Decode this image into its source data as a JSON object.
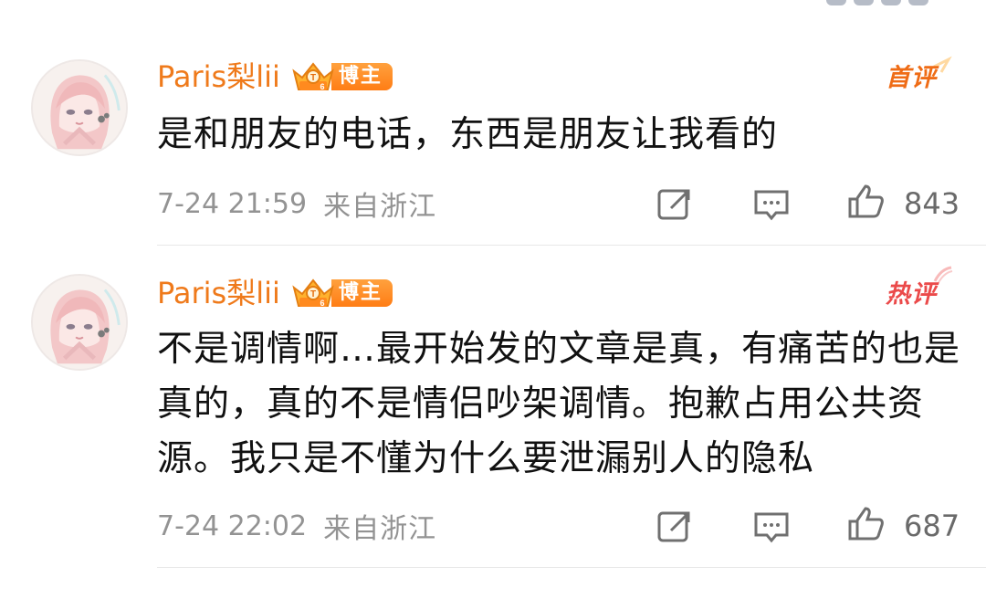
{
  "comments": [
    {
      "username": "Paris梨lii",
      "badge_label": "博主",
      "tag": "首评",
      "content": "是和朋友的电话，东西是朋友让我看的",
      "time": "7-24 21:59",
      "location": "来自浙江",
      "likes": "843"
    },
    {
      "username": "Paris梨lii",
      "badge_label": "博主",
      "tag": "热评",
      "content": "不是调情啊…最开始发的文章是真，有痛苦的也是真的，真的不是情侣吵架调情。抱歉占用公共资源。我只是不懂为什么要泄漏别人的隐私",
      "time": "7-24 22:02",
      "location": "来自浙江",
      "likes": "687"
    }
  ],
  "colors": {
    "username": "#ef7a1b",
    "tag_first": "#ef6c16",
    "tag_hot": "#eb4a4a",
    "badge_orange": "#ff8a1f",
    "meta_gray": "#939393",
    "divider": "#e8e8e8"
  },
  "icons": {
    "share": "share-icon",
    "comment": "comment-icon",
    "like": "like-icon",
    "vip": "vip-crown-icon"
  }
}
